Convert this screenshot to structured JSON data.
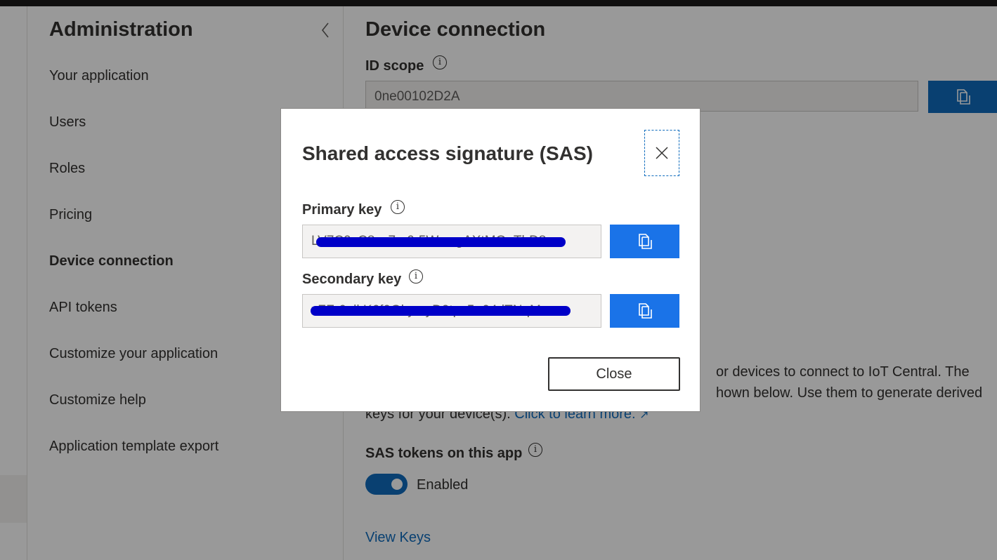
{
  "sidebar": {
    "title": "Administration",
    "items": [
      {
        "label": "Your application"
      },
      {
        "label": "Users"
      },
      {
        "label": "Roles"
      },
      {
        "label": "Pricing"
      },
      {
        "label": "Device connection",
        "active": true
      },
      {
        "label": "API tokens"
      },
      {
        "label": "Customize your application"
      },
      {
        "label": "Customize help"
      },
      {
        "label": "Application template export"
      }
    ]
  },
  "main": {
    "title": "Device connection",
    "id_scope_label": "ID scope",
    "id_scope_value": "0ne00102D2A",
    "description_line1": "or devices to connect to IoT Central. The",
    "description_line2": "hown below. Use them to generate derived",
    "description_line3_prefix": "keys for your device(s).",
    "learn_more": "Click to learn more.",
    "sas_label": "SAS tokens on this app",
    "toggle_label": "Enabled",
    "toggle_on": true,
    "view_keys": "View Keys"
  },
  "dialog": {
    "title": "Shared access signature (SAS)",
    "primary_label": "Primary key",
    "primary_value": "LV7C9cC8zz7m6r5WnwgAXtMOoTbD8...",
    "secondary_label": "Secondary key",
    "secondary_value": "xZFr6nlkK6f0GkymyD2tpc5=04dTNqM...",
    "close_label": "Close"
  },
  "colors": {
    "accent": "#1a73e8",
    "overlay": "rgba(0,0,0,0.4)",
    "redaction": "#0000c8"
  },
  "icons": [
    "chevron-left-icon",
    "info-icon",
    "copy-icon",
    "close-icon",
    "external-link-icon"
  ]
}
